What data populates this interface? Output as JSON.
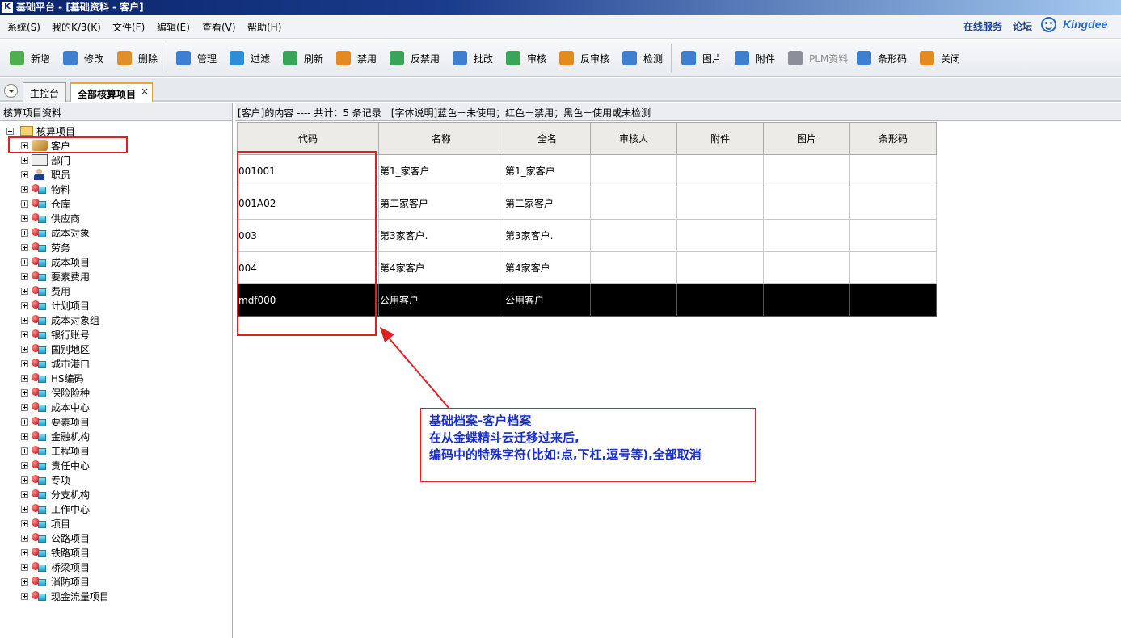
{
  "window": {
    "title": "基础平台 - [基础资料 - 客户]",
    "app_icon_text": "K"
  },
  "menu": {
    "items": [
      "系统(S)",
      "我的K/3(K)",
      "文件(F)",
      "编辑(E)",
      "查看(V)",
      "帮助(H)"
    ],
    "online_service": "在线服务",
    "forum": "论坛",
    "brand": "Kingdee"
  },
  "toolbar": {
    "buttons": [
      {
        "label": "新增",
        "icon": "add-icon",
        "color": "#4caf50"
      },
      {
        "label": "修改",
        "icon": "edit-icon",
        "color": "#3f7fd1"
      },
      {
        "label": "删除",
        "icon": "trash-icon",
        "color": "#e0902a"
      },
      {
        "label": "管理",
        "icon": "tools-icon",
        "color": "#3f7fd1"
      },
      {
        "label": "过滤",
        "icon": "filter-icon",
        "color": "#2c8ed6"
      },
      {
        "label": "刷新",
        "icon": "refresh-icon",
        "color": "#3aa55a"
      },
      {
        "label": "禁用",
        "icon": "disable-icon",
        "color": "#e58a1f"
      },
      {
        "label": "反禁用",
        "icon": "enable-icon",
        "color": "#3aa55a"
      },
      {
        "label": "批改",
        "icon": "batch-edit-icon",
        "color": "#3f7fd1"
      },
      {
        "label": "审核",
        "icon": "approve-icon",
        "color": "#3aa55a"
      },
      {
        "label": "反审核",
        "icon": "unapprove-icon",
        "color": "#e58a1f"
      },
      {
        "label": "检测",
        "icon": "inspect-icon",
        "color": "#3f7fd1"
      },
      {
        "label": "图片",
        "icon": "picture-icon",
        "color": "#3f7fd1"
      },
      {
        "label": "附件",
        "icon": "attachment-icon",
        "color": "#3f7fd1"
      },
      {
        "label": "PLM资料",
        "icon": "plm-icon",
        "color": "#8a8f99",
        "disabled": true
      },
      {
        "label": "条形码",
        "icon": "barcode-icon",
        "color": "#3f7fd1"
      },
      {
        "label": "关闭",
        "icon": "close-door-icon",
        "color": "#e58a1f"
      }
    ]
  },
  "tabs": {
    "home": "主控台",
    "active": "全部核算项目",
    "close_glyph": "×"
  },
  "left_panel": {
    "header": "核算项目资料",
    "root": "核算项目",
    "items": [
      {
        "label": "客户",
        "icon": "customer-icon"
      },
      {
        "label": "部门",
        "icon": "department-icon"
      },
      {
        "label": "职员",
        "icon": "employee-icon"
      },
      {
        "label": "物料",
        "icon": "item-icon"
      },
      {
        "label": "仓库",
        "icon": "item-icon"
      },
      {
        "label": "供应商",
        "icon": "item-icon"
      },
      {
        "label": "成本对象",
        "icon": "item-icon"
      },
      {
        "label": "劳务",
        "icon": "item-icon"
      },
      {
        "label": "成本项目",
        "icon": "item-icon"
      },
      {
        "label": "要素费用",
        "icon": "item-icon"
      },
      {
        "label": "费用",
        "icon": "item-icon"
      },
      {
        "label": "计划项目",
        "icon": "item-icon"
      },
      {
        "label": "成本对象组",
        "icon": "item-icon"
      },
      {
        "label": "银行账号",
        "icon": "item-icon"
      },
      {
        "label": "国别地区",
        "icon": "item-icon"
      },
      {
        "label": "城市港口",
        "icon": "item-icon"
      },
      {
        "label": "HS编码",
        "icon": "item-icon"
      },
      {
        "label": "保险险种",
        "icon": "item-icon"
      },
      {
        "label": "成本中心",
        "icon": "item-icon"
      },
      {
        "label": "要素项目",
        "icon": "item-icon"
      },
      {
        "label": "金融机构",
        "icon": "item-icon"
      },
      {
        "label": "工程项目",
        "icon": "item-icon"
      },
      {
        "label": "责任中心",
        "icon": "item-icon"
      },
      {
        "label": "专项",
        "icon": "item-icon"
      },
      {
        "label": "分支机构",
        "icon": "item-icon"
      },
      {
        "label": "工作中心",
        "icon": "item-icon"
      },
      {
        "label": "项目",
        "icon": "item-icon"
      },
      {
        "label": "公路项目",
        "icon": "item-icon"
      },
      {
        "label": "铁路项目",
        "icon": "item-icon"
      },
      {
        "label": "桥梁项目",
        "icon": "item-icon"
      },
      {
        "label": "消防项目",
        "icon": "item-icon"
      },
      {
        "label": "现金流量项目",
        "icon": "item-icon"
      }
    ]
  },
  "grid": {
    "info": "[客户]的内容 ---- 共计：5 条记录　[字体说明]蓝色－未使用；红色－禁用；黑色－使用或未检测",
    "columns": [
      "代码",
      "名称",
      "全名",
      "审核人",
      "附件",
      "图片",
      "条形码"
    ],
    "rows": [
      [
        "001001",
        "第1_家客户",
        "第1_家客户",
        "",
        "",
        "",
        ""
      ],
      [
        "001A02",
        "第二家客户",
        "第二家客户",
        "",
        "",
        "",
        ""
      ],
      [
        "003",
        "第3家客户.",
        "第3家客户.",
        "",
        "",
        "",
        ""
      ],
      [
        "004",
        "第4家客户",
        "第4家客户",
        "",
        "",
        "",
        ""
      ],
      [
        "mdf000",
        "公用客户",
        "公用客户",
        "",
        "",
        "",
        ""
      ]
    ],
    "selected_row": 4
  },
  "annotation": {
    "lines": [
      "基础档案-客户档案",
      "在从金蝶精斗云迁移过来后,",
      "编码中的特殊字符(比如:点,下杠,逗号等),全部取消"
    ],
    "color": "#1a2fc9",
    "border_color": "#e02020"
  }
}
